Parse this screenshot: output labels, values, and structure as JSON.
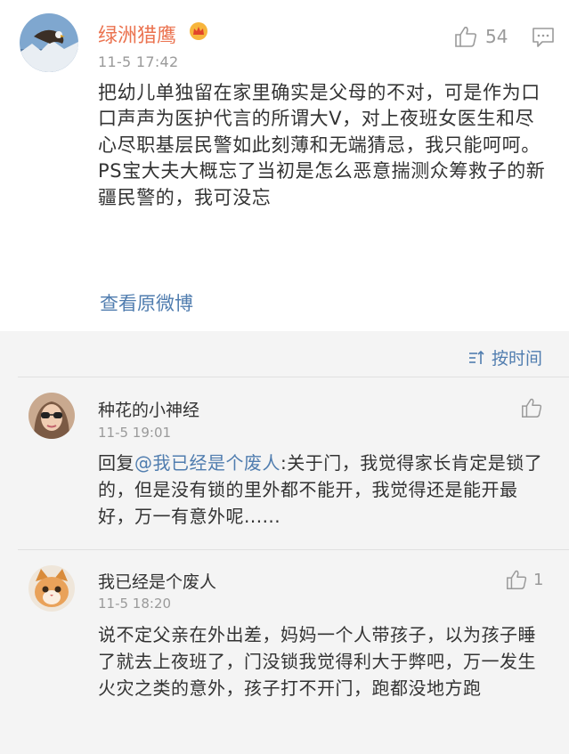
{
  "main_comment": {
    "user_name": "绿洲猎鹰",
    "timestamp": "11-5 17:42",
    "like_count": "54",
    "text": "把幼儿单独留在家里确实是父母的不对，可是作为口口声声为医护代言的所谓大V，对上夜班女医生和尽心尽职基层民警如此刻薄和无端猜忌，我只能呵呵。PS宝大夫大概忘了当初是怎么恶意揣测众筹救子的新疆民警的，我可没忘",
    "view_original_label": "查看原微博",
    "icons": [
      "avatar-eagle",
      "vip-crown-icon",
      "thumbs-up-icon",
      "comment-icon"
    ],
    "name_color": "#eb7350"
  },
  "sort": {
    "label": "按时间",
    "icon": "sort-icon"
  },
  "replies": [
    {
      "user_name": "种花的小神经",
      "timestamp": "11-5 19:01",
      "like_count": "",
      "reply_prefix": "回复",
      "mention": "@我已经是个废人",
      "text": ":关于门，我觉得家长肯定是锁了的，但是没有锁的里外都不能开，我觉得还是能开最好，万一有意外呢......"
    },
    {
      "user_name": "我已经是个废人",
      "timestamp": "11-5 18:20",
      "like_count": "1",
      "text": "说不定父亲在外出差，妈妈一个人带孩子，以为孩子睡了就去上夜班了，门没锁我觉得利大于弊吧，万一发生火灾之类的意外，孩子打不开门，跑都没地方跑"
    }
  ],
  "colors": {
    "link": "#507daf",
    "muted": "#9a9a9a",
    "text": "#333333",
    "background_gray": "#f4f4f4"
  }
}
